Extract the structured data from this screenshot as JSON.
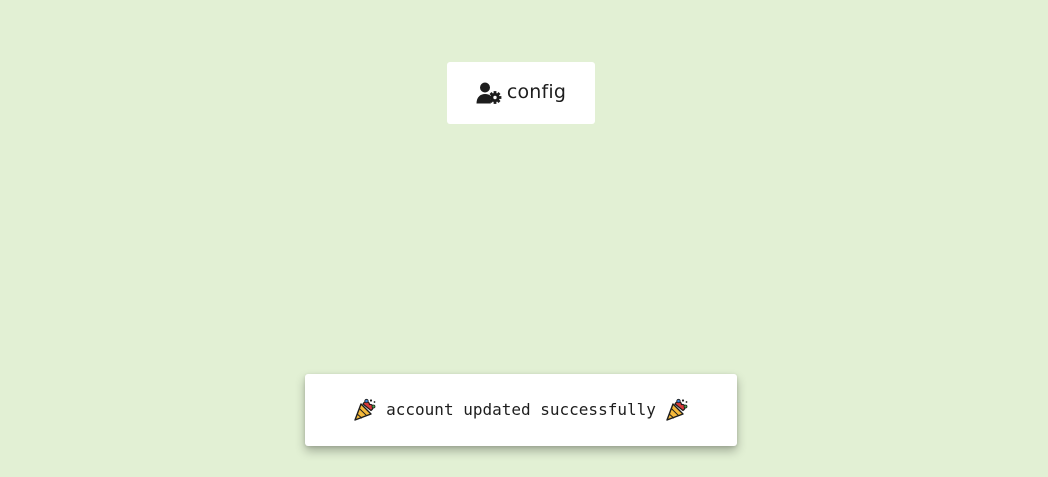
{
  "config_button": {
    "label": "config",
    "icon": "user-gear-icon"
  },
  "toast": {
    "message": "account updated successfully",
    "leading_icon": "party-popper-icon",
    "trailing_icon": "party-popper-icon"
  },
  "colors": {
    "background": "#e2f0d4",
    "surface": "#ffffff",
    "text": "#1d1d1d"
  }
}
